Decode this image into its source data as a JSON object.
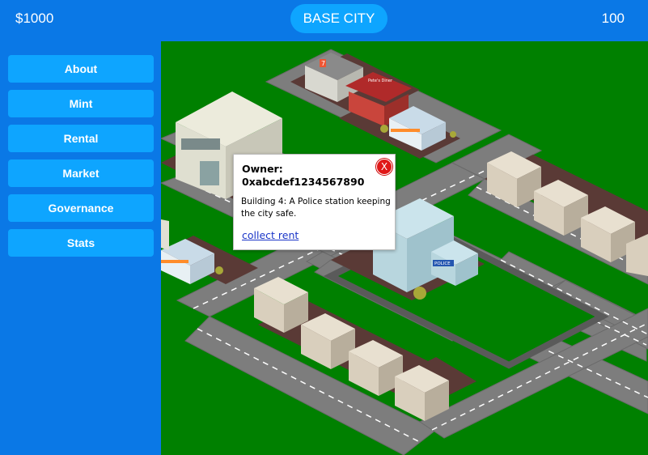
{
  "header": {
    "balance": "$1000",
    "title": "BASE CITY",
    "score": "100"
  },
  "sidebar": {
    "items": [
      {
        "label": "About"
      },
      {
        "label": "Mint"
      },
      {
        "label": "Rental"
      },
      {
        "label": "Market"
      },
      {
        "label": "Governance"
      },
      {
        "label": "Stats"
      }
    ]
  },
  "popup": {
    "owner_label": "Owner:",
    "owner_address": "0xabcdef1234567890",
    "description": "Building 4: A Police station keeping the city safe.",
    "action_link": "collect rent",
    "close_label": "X"
  },
  "map": {
    "shop_sign": "7",
    "diner_sign": "Pete's Diner",
    "police_sign": "POLICE"
  },
  "colors": {
    "header_bg": "#0a78e6",
    "button_bg": "#0ea5ff",
    "grass": "#008000",
    "road": "#7a7a7a",
    "close_button": "#e01818",
    "link": "#1a35c8"
  }
}
